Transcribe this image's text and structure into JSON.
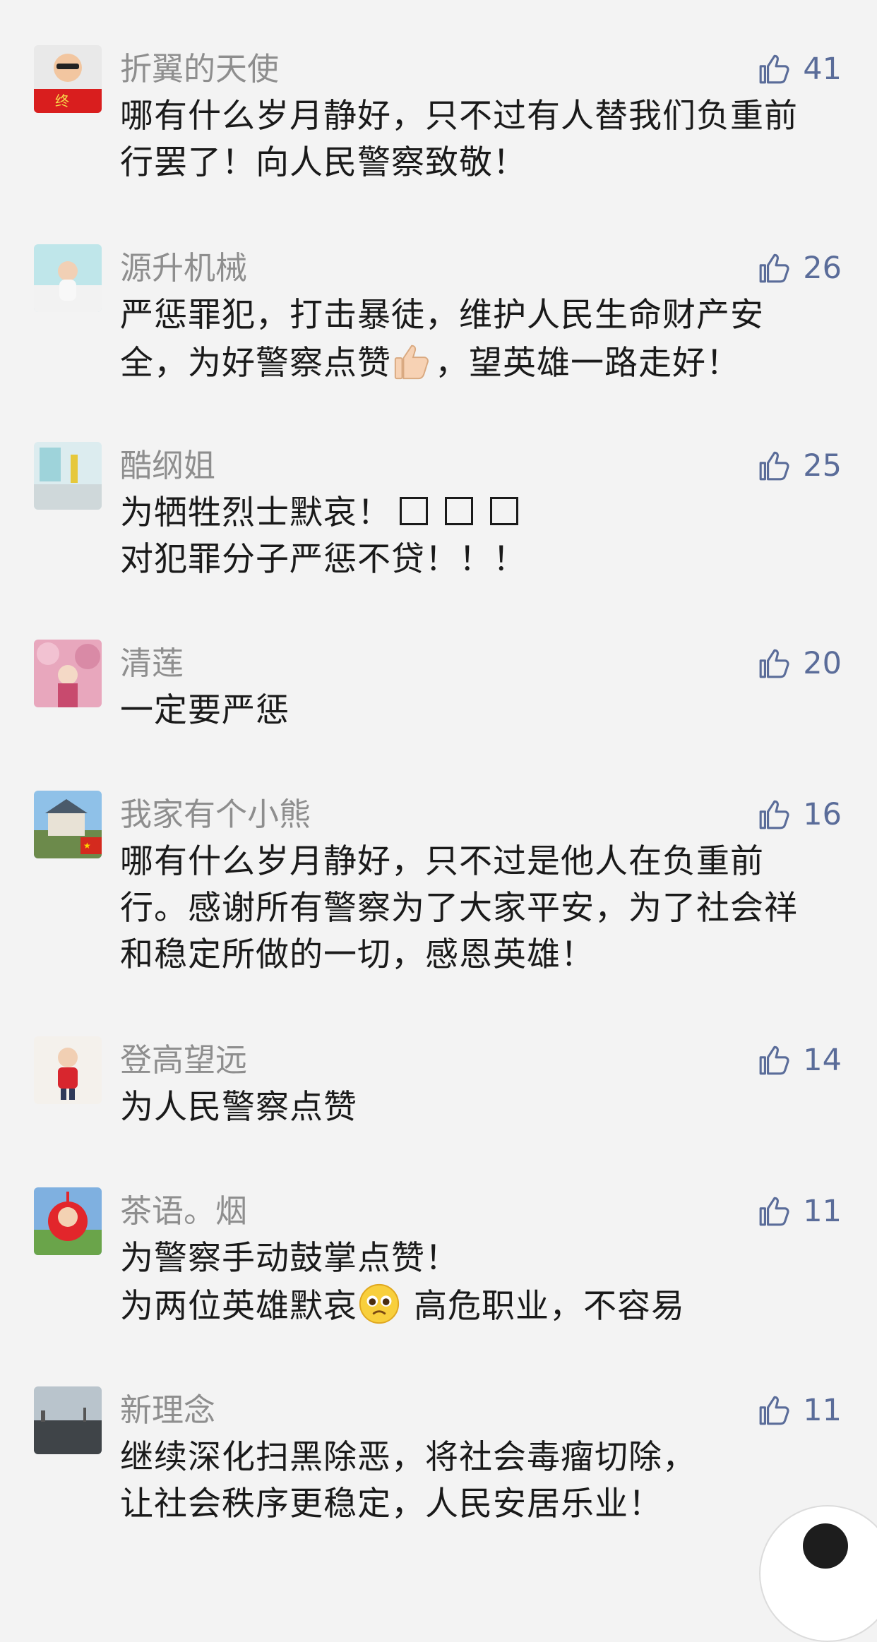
{
  "comments": [
    {
      "username": "折翼的天使",
      "likes": "41",
      "lines": [
        "哪有什么岁月静好，只不过有人替我们负重前",
        "行罢了！向人民警察致敬！"
      ]
    },
    {
      "username": "源升机械",
      "likes": "26",
      "lines": [
        "严惩罪犯，打击暴徒，维护人民生命财产安",
        "全，为好警察点赞",
        "，望英雄一路走好！"
      ]
    },
    {
      "username": "酷纲姐",
      "likes": "25",
      "lines": [
        "为牺牲烈士默哀！",
        "对犯罪分子严惩不贷！！！"
      ]
    },
    {
      "username": "清莲",
      "likes": "20",
      "lines": [
        "一定要严惩"
      ]
    },
    {
      "username": "我家有个小熊",
      "likes": "16",
      "lines": [
        "哪有什么岁月静好，只不过是他人在负重前",
        "行。感谢所有警察为了大家平安，为了社会祥",
        "和稳定所做的一切，感恩英雄！"
      ]
    },
    {
      "username": "登高望远",
      "likes": "14",
      "lines": [
        "为人民警察点赞"
      ]
    },
    {
      "username": "茶语。烟",
      "likes": "11",
      "lines": [
        "为警察手动鼓掌点赞！",
        "为两位英雄默哀",
        "高危职业，不容易"
      ]
    },
    {
      "username": "新理念",
      "likes": "11",
      "lines": [
        "继续深化扫黑除恶，将社会毒瘤切除，",
        "让社会秩序更稳定，人民安居乐业！"
      ]
    }
  ],
  "icons": {
    "like": "thumbs-up-icon",
    "emoji_thumbs": "thumbs-up-emoji",
    "emoji_pleading": "pleading-face-emoji",
    "missing_glyph": "missing-glyph-box"
  },
  "colors": {
    "background": "#f3f3f3",
    "username": "#8e8e8e",
    "like_accent": "#5a6c99",
    "text": "#1a1a1a"
  }
}
